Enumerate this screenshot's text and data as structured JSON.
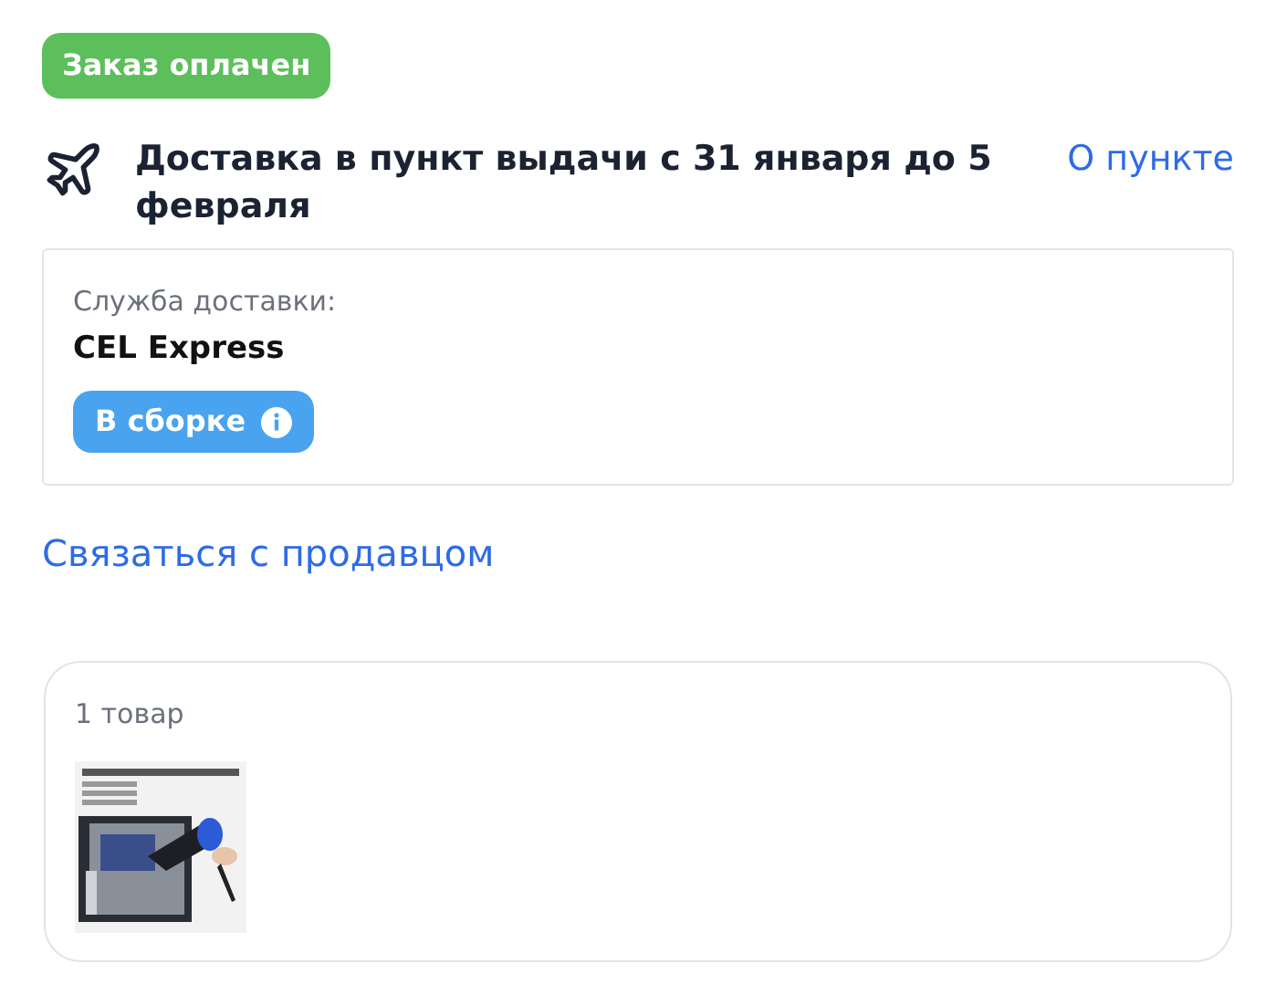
{
  "status_badge": "Заказ оплачен",
  "delivery": {
    "title": "Доставка в пункт выдачи с 31 января до 5 февраля",
    "link": "О пункте"
  },
  "service": {
    "label": "Служба доставки:",
    "name": "CEL Express",
    "status": "В сборке"
  },
  "contact_link": "Связаться с продавцом",
  "items": {
    "count": "1 товар"
  }
}
